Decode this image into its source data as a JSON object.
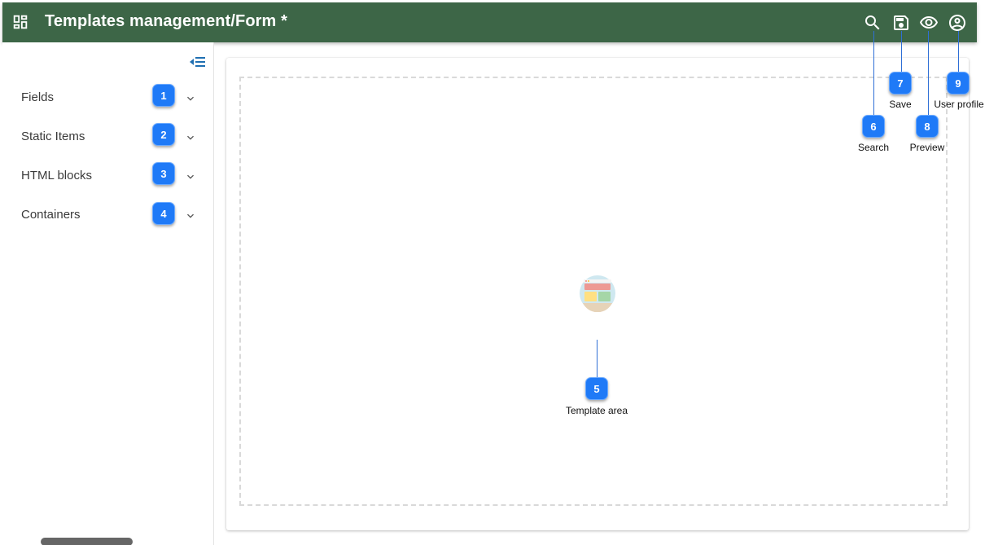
{
  "header": {
    "title": "Templates management/Form *",
    "background": "#3d6647",
    "icons": [
      "apps-icon",
      "search-icon",
      "save-icon",
      "preview-eye-icon",
      "user-profile-icon"
    ]
  },
  "sidebar": {
    "collapse_icon": "collapse-menu-icon",
    "items": [
      {
        "label": "Fields",
        "badge": "1"
      },
      {
        "label": "Static Items",
        "badge": "2"
      },
      {
        "label": "HTML blocks",
        "badge": "3"
      },
      {
        "label": "Containers",
        "badge": "4"
      }
    ]
  },
  "main": {
    "template_area_icon": "template-layout-illustration"
  },
  "callouts": {
    "template_area": {
      "number": "5",
      "label": "Template area"
    },
    "search": {
      "number": "6",
      "label": "Search"
    },
    "save": {
      "number": "7",
      "label": "Save"
    },
    "preview": {
      "number": "8",
      "label": "Preview"
    },
    "user_profile": {
      "number": "9",
      "label": "User profile"
    }
  },
  "colors": {
    "accent": "#1f7af7",
    "header": "#3d6647",
    "callout_line": "#2f6fd6"
  }
}
